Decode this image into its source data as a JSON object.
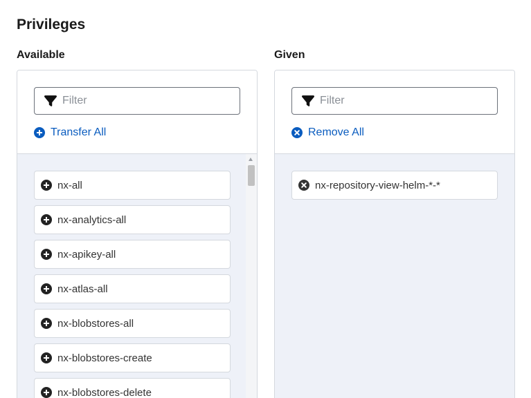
{
  "page": {
    "title": "Privileges"
  },
  "available": {
    "label": "Available",
    "filter_placeholder": "Filter",
    "action_label": "Transfer All",
    "items": [
      "nx-all",
      "nx-analytics-all",
      "nx-apikey-all",
      "nx-atlas-all",
      "nx-blobstores-all",
      "nx-blobstores-create",
      "nx-blobstores-delete"
    ]
  },
  "given": {
    "label": "Given",
    "filter_placeholder": "Filter",
    "action_label": "Remove All",
    "items": [
      "nx-repository-view-helm-*-*"
    ]
  },
  "icons": {
    "filter": "filter-icon",
    "add": "plus-circle-icon",
    "remove": "x-circle-icon"
  },
  "colors": {
    "accent": "#0a5cbf",
    "list_background": "#eef1f8",
    "border": "#d4d8de"
  }
}
